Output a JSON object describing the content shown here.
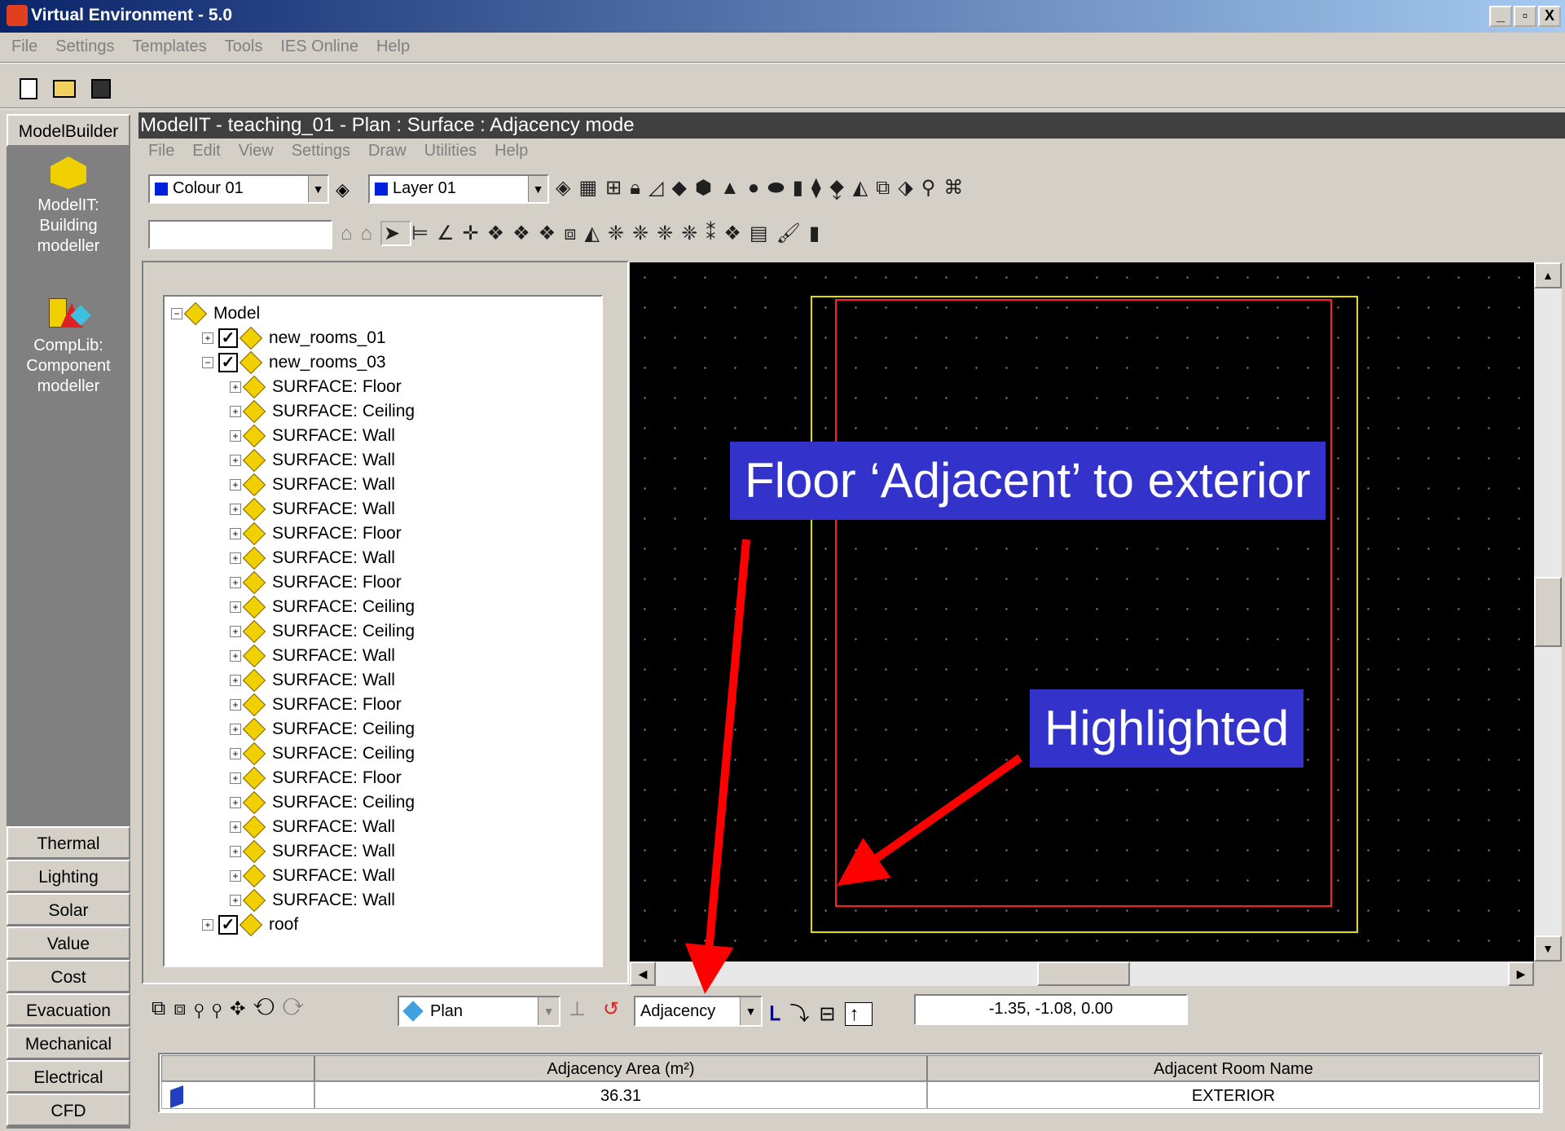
{
  "window": {
    "title": "Virtual Environment - 5.0",
    "controls": [
      "_",
      "▫",
      "X"
    ]
  },
  "main_menu": [
    "File",
    "Settings",
    "Templates",
    "Tools",
    "IES Online",
    "Help"
  ],
  "sidebar": {
    "top_tab": "ModelBuilder",
    "tools": [
      {
        "lines": [
          "ModelIT:",
          "Building",
          "modeller"
        ]
      },
      {
        "lines": [
          "CompLib:",
          "Component",
          "modeller"
        ]
      }
    ],
    "tabs": [
      "Thermal",
      "Lighting",
      "Solar",
      "Value",
      "Cost",
      "Evacuation",
      "Mechanical",
      "Electrical",
      "CFD"
    ]
  },
  "modelit": {
    "title": "ModelIT - teaching_01 - Plan : Surface : Adjacency mode",
    "menu": [
      "File",
      "Edit",
      "View",
      "Settings",
      "Draw",
      "Utilities",
      "Help"
    ],
    "colour_select": "Colour 01",
    "layer_select": "Layer 01",
    "text_input": ""
  },
  "tree": {
    "root": "Model",
    "rooms": [
      "new_rooms_01",
      "new_rooms_03"
    ],
    "surfaces": [
      "SURFACE: Floor",
      "SURFACE: Ceiling",
      "SURFACE: Wall",
      "SURFACE: Wall",
      "SURFACE: Wall",
      "SURFACE: Wall",
      "SURFACE: Floor",
      "SURFACE: Wall",
      "SURFACE: Floor",
      "SURFACE: Ceiling",
      "SURFACE: Ceiling",
      "SURFACE: Wall",
      "SURFACE: Wall",
      "SURFACE: Floor",
      "SURFACE: Ceiling",
      "SURFACE: Ceiling",
      "SURFACE: Floor",
      "SURFACE: Ceiling",
      "SURFACE: Wall",
      "SURFACE: Wall",
      "SURFACE: Wall",
      "SURFACE: Wall"
    ],
    "last": "roof"
  },
  "bottom_toolbar": {
    "view_select": "Plan",
    "mode_select": "Adjacency",
    "coordinates": "-1.35,  -1.08,  0.00"
  },
  "table": {
    "columns": [
      "",
      "Adjacency Area (m²)",
      "Adjacent Room Name"
    ],
    "rows": [
      {
        "area": "36.31",
        "room": "EXTERIOR"
      }
    ]
  },
  "callouts": {
    "floor": "Floor ‘Adjacent’ to exterior",
    "highlighted": "Highlighted"
  },
  "colors": {
    "callout_bg": "#3333cc",
    "arrow": "#ff0000",
    "outer_rect": "#e0e000",
    "inner_rect": "#ff2020",
    "canvas": "#000000"
  }
}
